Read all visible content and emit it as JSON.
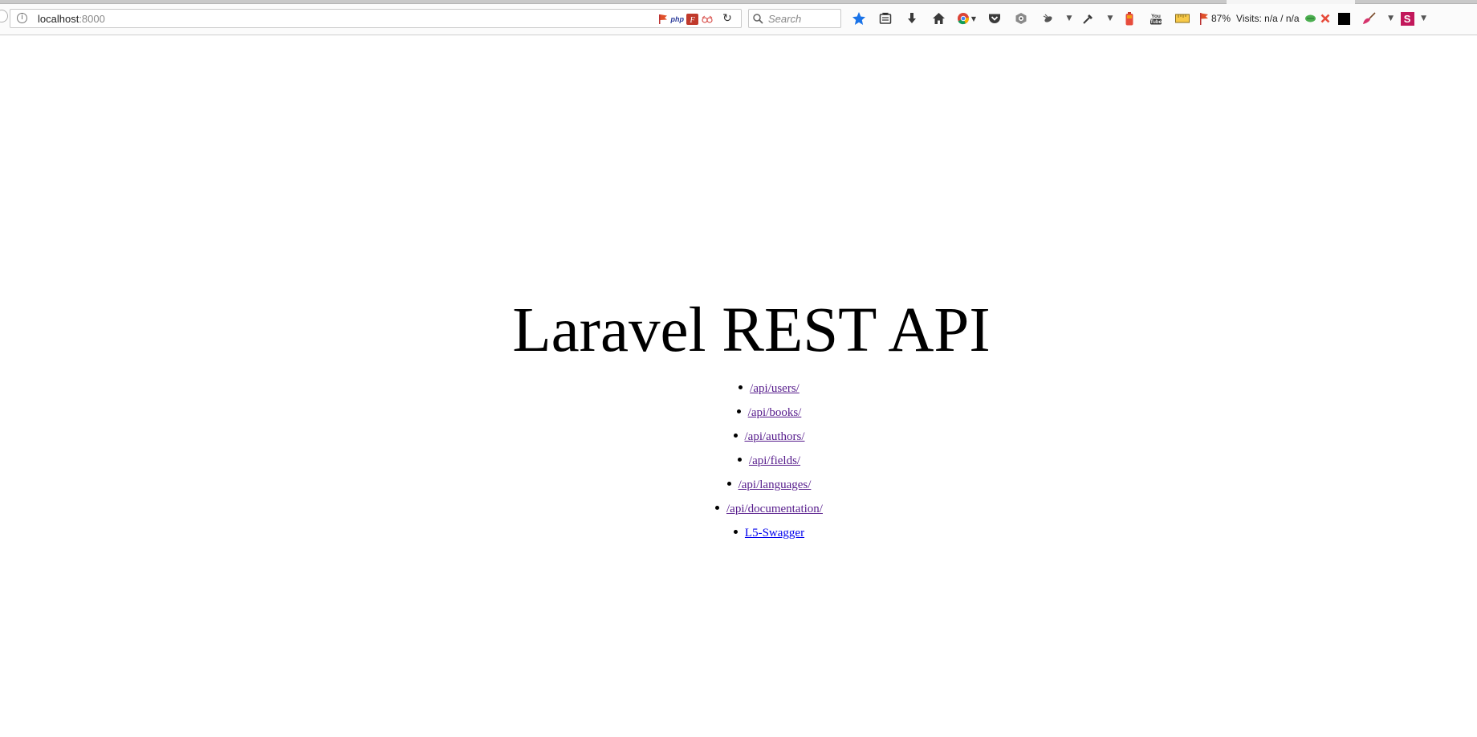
{
  "browser": {
    "url_host": "localhost",
    "url_port": ":8000",
    "search_placeholder": "Search",
    "zoom_text": "87%",
    "visits_text": "Visits: n/a / n/a",
    "icons": {
      "url_bar": [
        "flag-icon",
        "php-icon",
        "feedly-icon",
        "glasses-icon",
        "reload-icon"
      ],
      "toolbar": [
        "bookmark-star-icon",
        "reading-list-icon",
        "download-icon",
        "home-icon",
        "chrome-icon",
        "pocket-icon",
        "privacy-badger-icon",
        "wasp-icon",
        "eyedropper-icon",
        "battery-icon",
        "youtube-icon",
        "ruler-icon",
        "flag-icon",
        "cookie-icon",
        "close-x-icon",
        "broom-icon",
        "s-extension-icon"
      ]
    }
  },
  "page": {
    "title": "Laravel REST API",
    "links": [
      {
        "label": "/api/users/",
        "visited": true
      },
      {
        "label": "/api/books/",
        "visited": true
      },
      {
        "label": "/api/authors/",
        "visited": true
      },
      {
        "label": "/api/fields/",
        "visited": true
      },
      {
        "label": "/api/languages/",
        "visited": true
      },
      {
        "label": "/api/documentation/",
        "visited": true
      },
      {
        "label": "L5-Swagger",
        "visited": false
      }
    ]
  }
}
